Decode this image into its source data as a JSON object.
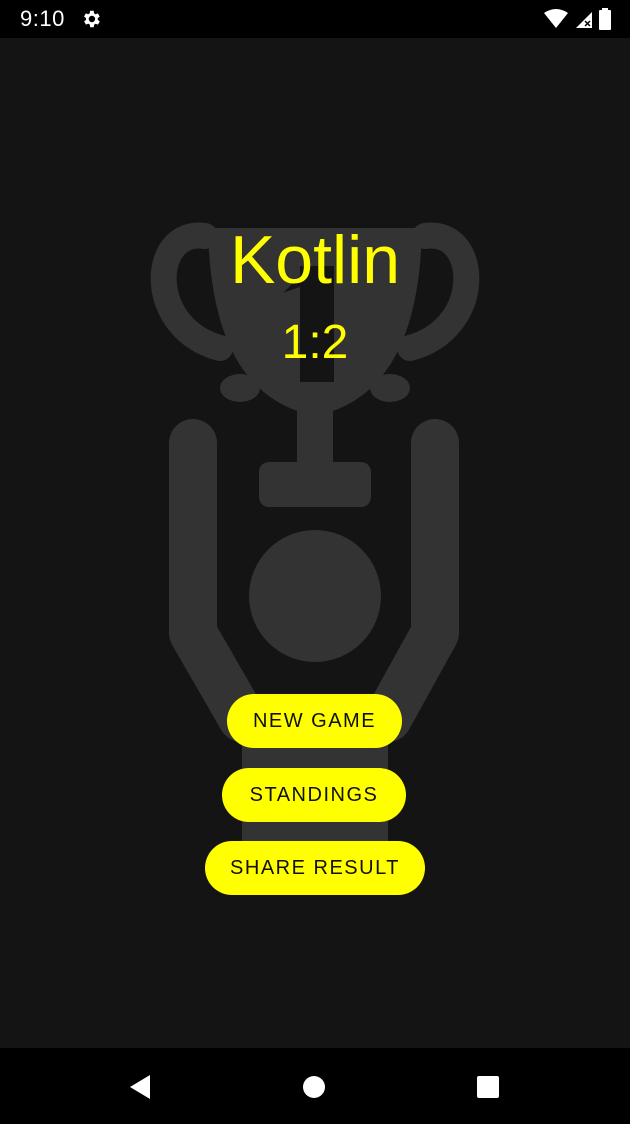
{
  "status_bar": {
    "time": "9:10",
    "icons": [
      "gear-icon",
      "wifi-icon",
      "signal-icon",
      "battery-icon"
    ]
  },
  "result": {
    "winner": "Kotlin",
    "score": "1:2"
  },
  "buttons": {
    "new_game": "NEW GAME",
    "standings": "STANDINGS",
    "share_result": "SHARE RESULT"
  },
  "nav_bar": {
    "icons": [
      "back-icon",
      "home-icon",
      "recents-icon"
    ]
  },
  "colors": {
    "background": "#141414",
    "accent": "#ffff00",
    "illustration": "#333333",
    "bars": "#000000"
  }
}
